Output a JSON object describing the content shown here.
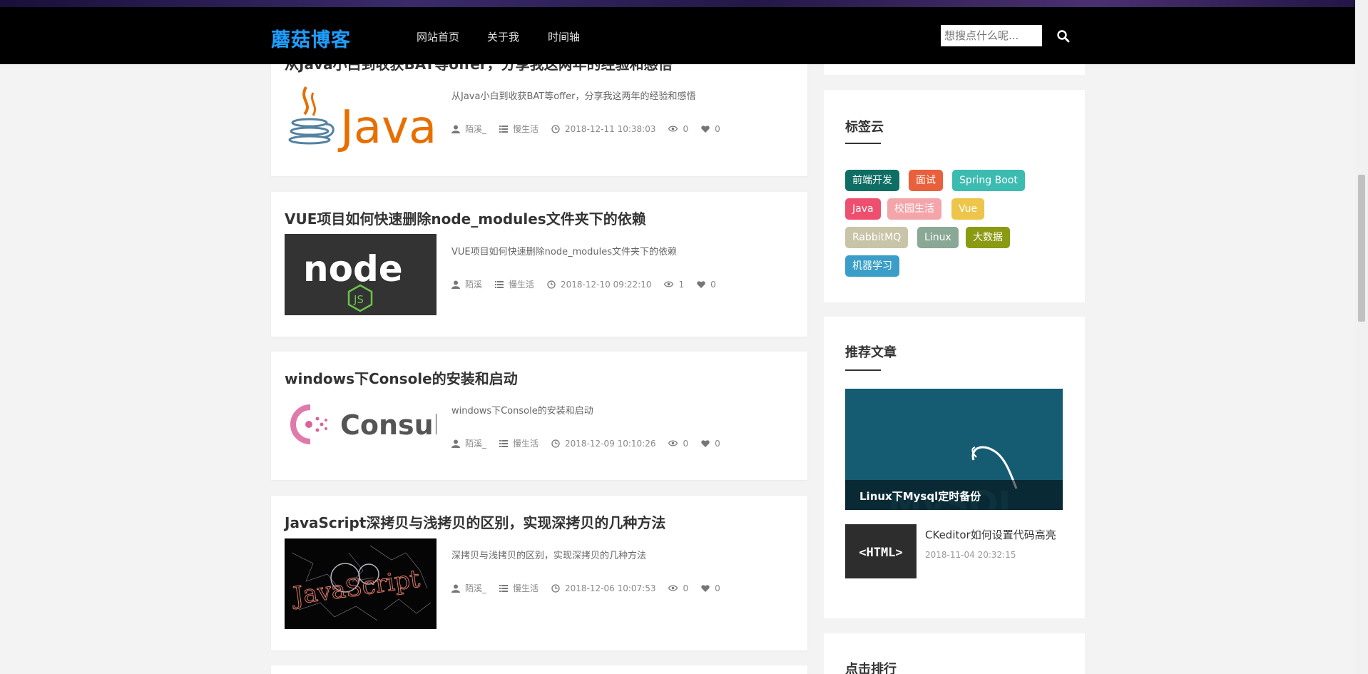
{
  "header": {
    "brand": "蘑菇博客",
    "nav": [
      "网站首页",
      "关于我",
      "时间轴"
    ],
    "search_placeholder": "想搜点什么呢..."
  },
  "articles": [
    {
      "title": "从Java小白到收获BAT等offer，分享我这两年的经验和感悟",
      "desc": "从Java小白到收获BAT等offer，分享我这两年的经验和感悟",
      "author": "陌溪_",
      "category": "慢生活",
      "date": "2018-12-11 10:38:03",
      "views": "0",
      "likes": "0",
      "image_label": "Java"
    },
    {
      "title": "VUE项目如何快速删除node_modules文件夹下的依赖",
      "desc": "VUE项目如何快速删除node_modules文件夹下的依赖",
      "author": "陌溪",
      "category": "慢生活",
      "date": "2018-12-10 09:22:10",
      "views": "1",
      "likes": "0",
      "image_label": "node"
    },
    {
      "title": "windows下Console的安装和启动",
      "desc": "windows下Console的安装和启动",
      "author": "陌溪_",
      "category": "慢生活",
      "date": "2018-12-09 10:10:26",
      "views": "0",
      "likes": "0",
      "image_label": "Consul"
    },
    {
      "title": "JavaScript深拷贝与浅拷贝的区别，实现深拷贝的几种方法",
      "desc": "深拷贝与浅拷贝的区别，实现深拷贝的几种方法",
      "author": "陌溪_",
      "category": "慢生活",
      "date": "2018-12-06 10:07:53",
      "views": "0",
      "likes": "0",
      "image_label": "JavaScript"
    }
  ],
  "sidebar": {
    "tags_title": "标签云",
    "tags": [
      {
        "label": "前端开发",
        "color": "#0f6e64"
      },
      {
        "label": "面试",
        "color": "#e8603c"
      },
      {
        "label": "Spring Boot",
        "color": "#3cbcb0"
      },
      {
        "label": "Java",
        "color": "#ef4f6e"
      },
      {
        "label": "校园生活",
        "color": "#f4a5aa"
      },
      {
        "label": "Vue",
        "color": "#edc54a"
      },
      {
        "label": "RabbitMQ",
        "color": "#c8c4a8"
      },
      {
        "label": "Linux",
        "color": "#8aa896"
      },
      {
        "label": "大数据",
        "color": "#8a9a12"
      },
      {
        "label": "机器学习",
        "color": "#3a9ec8"
      }
    ],
    "recommend_title": "推荐文章",
    "featured": {
      "title": "Linux下Mysql定时备份"
    },
    "recommend_items": [
      {
        "title": "CKeditor如何设置代码高亮",
        "date": "2018-11-04 20:32:15",
        "image_label": "<HTML>"
      }
    ],
    "ranking_title": "点击排行"
  }
}
